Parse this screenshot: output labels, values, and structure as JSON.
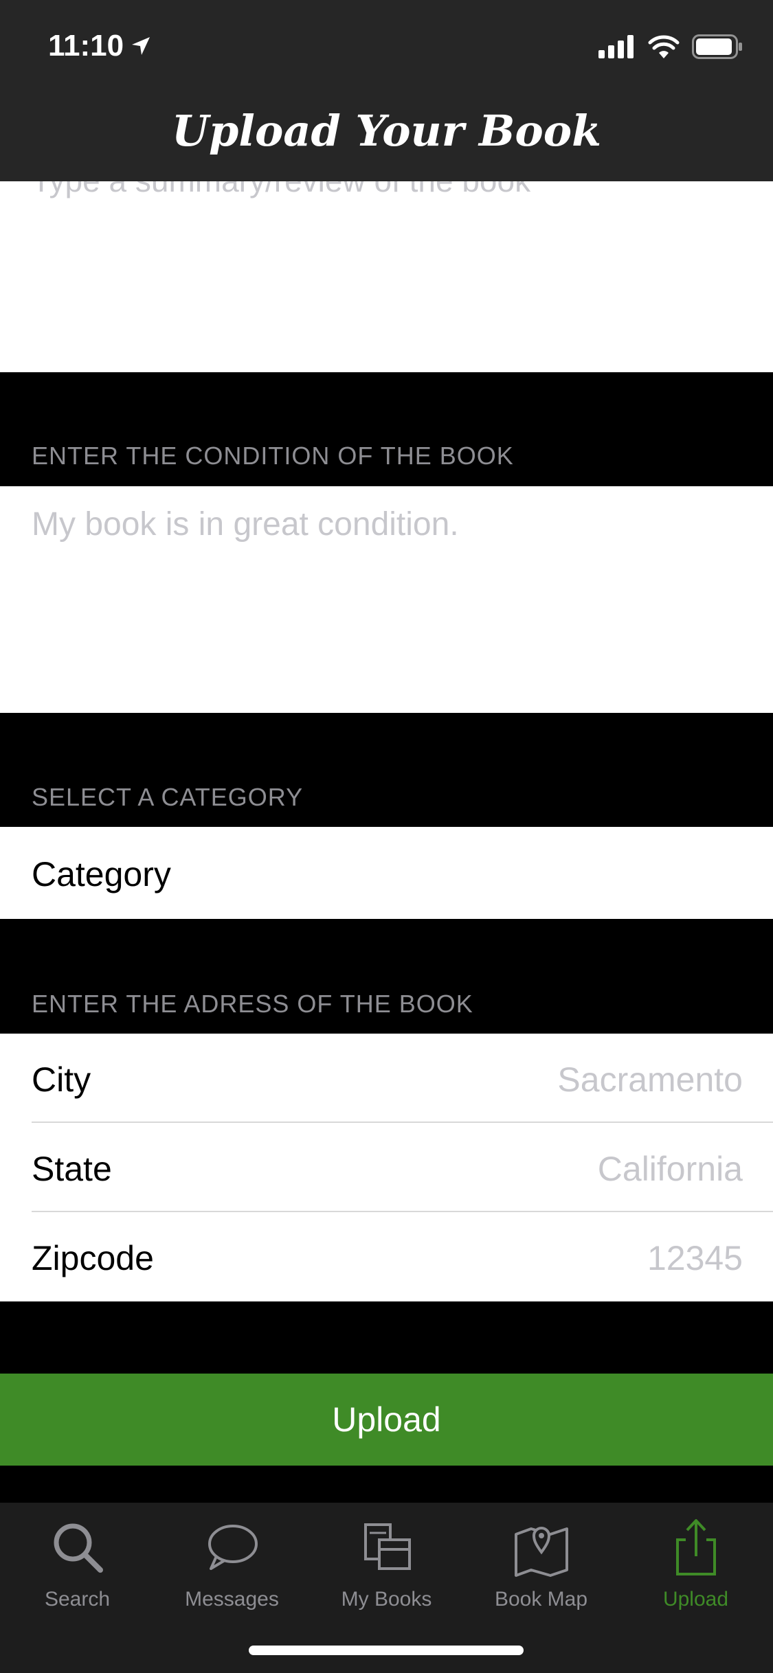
{
  "status": {
    "time": "11:10"
  },
  "header": {
    "title": "Upload Your Book"
  },
  "summary": {
    "placeholder": "Type a summary/review of the book"
  },
  "condition": {
    "header": "ENTER THE CONDITION OF THE BOOK",
    "placeholder": "My book is in great condition."
  },
  "category": {
    "header": "SELECT A CATEGORY",
    "label": "Category"
  },
  "address": {
    "header": "ENTER THE ADRESS OF THE BOOK",
    "city_label": "City",
    "city_placeholder": "Sacramento",
    "state_label": "State",
    "state_placeholder": "California",
    "zip_label": "Zipcode",
    "zip_placeholder": "12345"
  },
  "upload_button": {
    "label": "Upload"
  },
  "tabs": [
    {
      "label": "Search",
      "icon": "search-icon"
    },
    {
      "label": "Messages",
      "icon": "messages-icon"
    },
    {
      "label": "My Books",
      "icon": "books-icon"
    },
    {
      "label": "Book Map",
      "icon": "map-icon"
    },
    {
      "label": "Upload",
      "icon": "upload-icon",
      "active": true
    }
  ],
  "colors": {
    "accent": "#3f8b27",
    "bar": "#262626",
    "background": "#000000"
  }
}
